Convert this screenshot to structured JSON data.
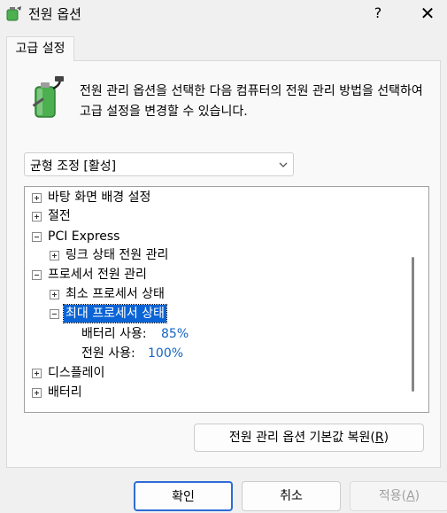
{
  "window": {
    "title": "전원 옵션",
    "help": "?",
    "close": "✕"
  },
  "tab": {
    "label": "고급 설정"
  },
  "description": "전원 관리 옵션을 선택한 다음 컴퓨터의 전원 관리 방법을 선택하여 고급 설정을 변경할 수 있습니다.",
  "plan": {
    "selected": "균형 조정 [활성]"
  },
  "tree": {
    "desktop_bg": "바탕 화면 배경 설정",
    "sleep": "절전",
    "pci_express": "PCI Express",
    "link_state": "링크 상태 전원 관리",
    "processor": "프로세서 전원 관리",
    "min_state": "최소 프로세서 상태",
    "max_state": "최대 프로세서 상태",
    "battery_label": "배터리 사용:",
    "battery_value": "85%",
    "plugged_label": "전원 사용:",
    "plugged_value": "100%",
    "display": "디스플레이",
    "battery": "배터리"
  },
  "buttons": {
    "restore_pre": "전원 관리 옵션 기본값 복원(",
    "restore_key": "R",
    "restore_post": ")",
    "ok": "확인",
    "cancel": "취소",
    "apply_pre": "적용(",
    "apply_key": "A",
    "apply_post": ")"
  },
  "colors": {
    "accent": "#0a64d6",
    "value_blue": "#1565c0",
    "battery_green": "#4caf50"
  }
}
